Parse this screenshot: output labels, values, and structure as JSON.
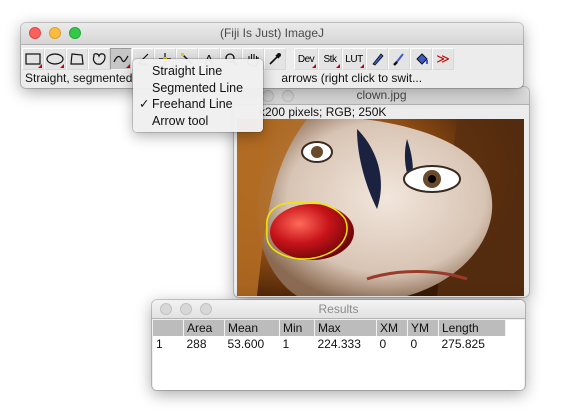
{
  "imagej_window": {
    "title": "(Fiji Is Just) ImageJ",
    "status_text": "Straight, segmented",
    "status_text_right": "arrows (right click to swit...",
    "toolbar": {
      "dev_label": "Dev",
      "stk_label": "Stk",
      "lut_label": "LUT",
      "text_tool_label": "A",
      "more_label": "≫"
    }
  },
  "line_menu": {
    "items": [
      {
        "label": "Straight Line",
        "checked": false
      },
      {
        "label": "Segmented Line",
        "checked": false
      },
      {
        "label": "Freehand Line",
        "checked": true
      },
      {
        "label": "Arrow tool",
        "checked": false
      }
    ],
    "check_glyph": "✓"
  },
  "image_window": {
    "title": "clown.jpg",
    "info": "k200 pixels; RGB; 250K"
  },
  "results_window": {
    "title": "Results",
    "columns": [
      "",
      "Area",
      "Mean",
      "Min",
      "Max",
      "XM",
      "YM",
      "Length"
    ],
    "rows": [
      [
        "1",
        "288",
        "53.600",
        "1",
        "224.333",
        "0",
        "0",
        "275.825"
      ]
    ]
  },
  "colors": {
    "selection_outline": "#f5e600",
    "header_bg": "#bcbcbc",
    "close_red": "#fc605c",
    "minimize_yellow": "#fdbc40",
    "zoom_green": "#34c84a"
  }
}
